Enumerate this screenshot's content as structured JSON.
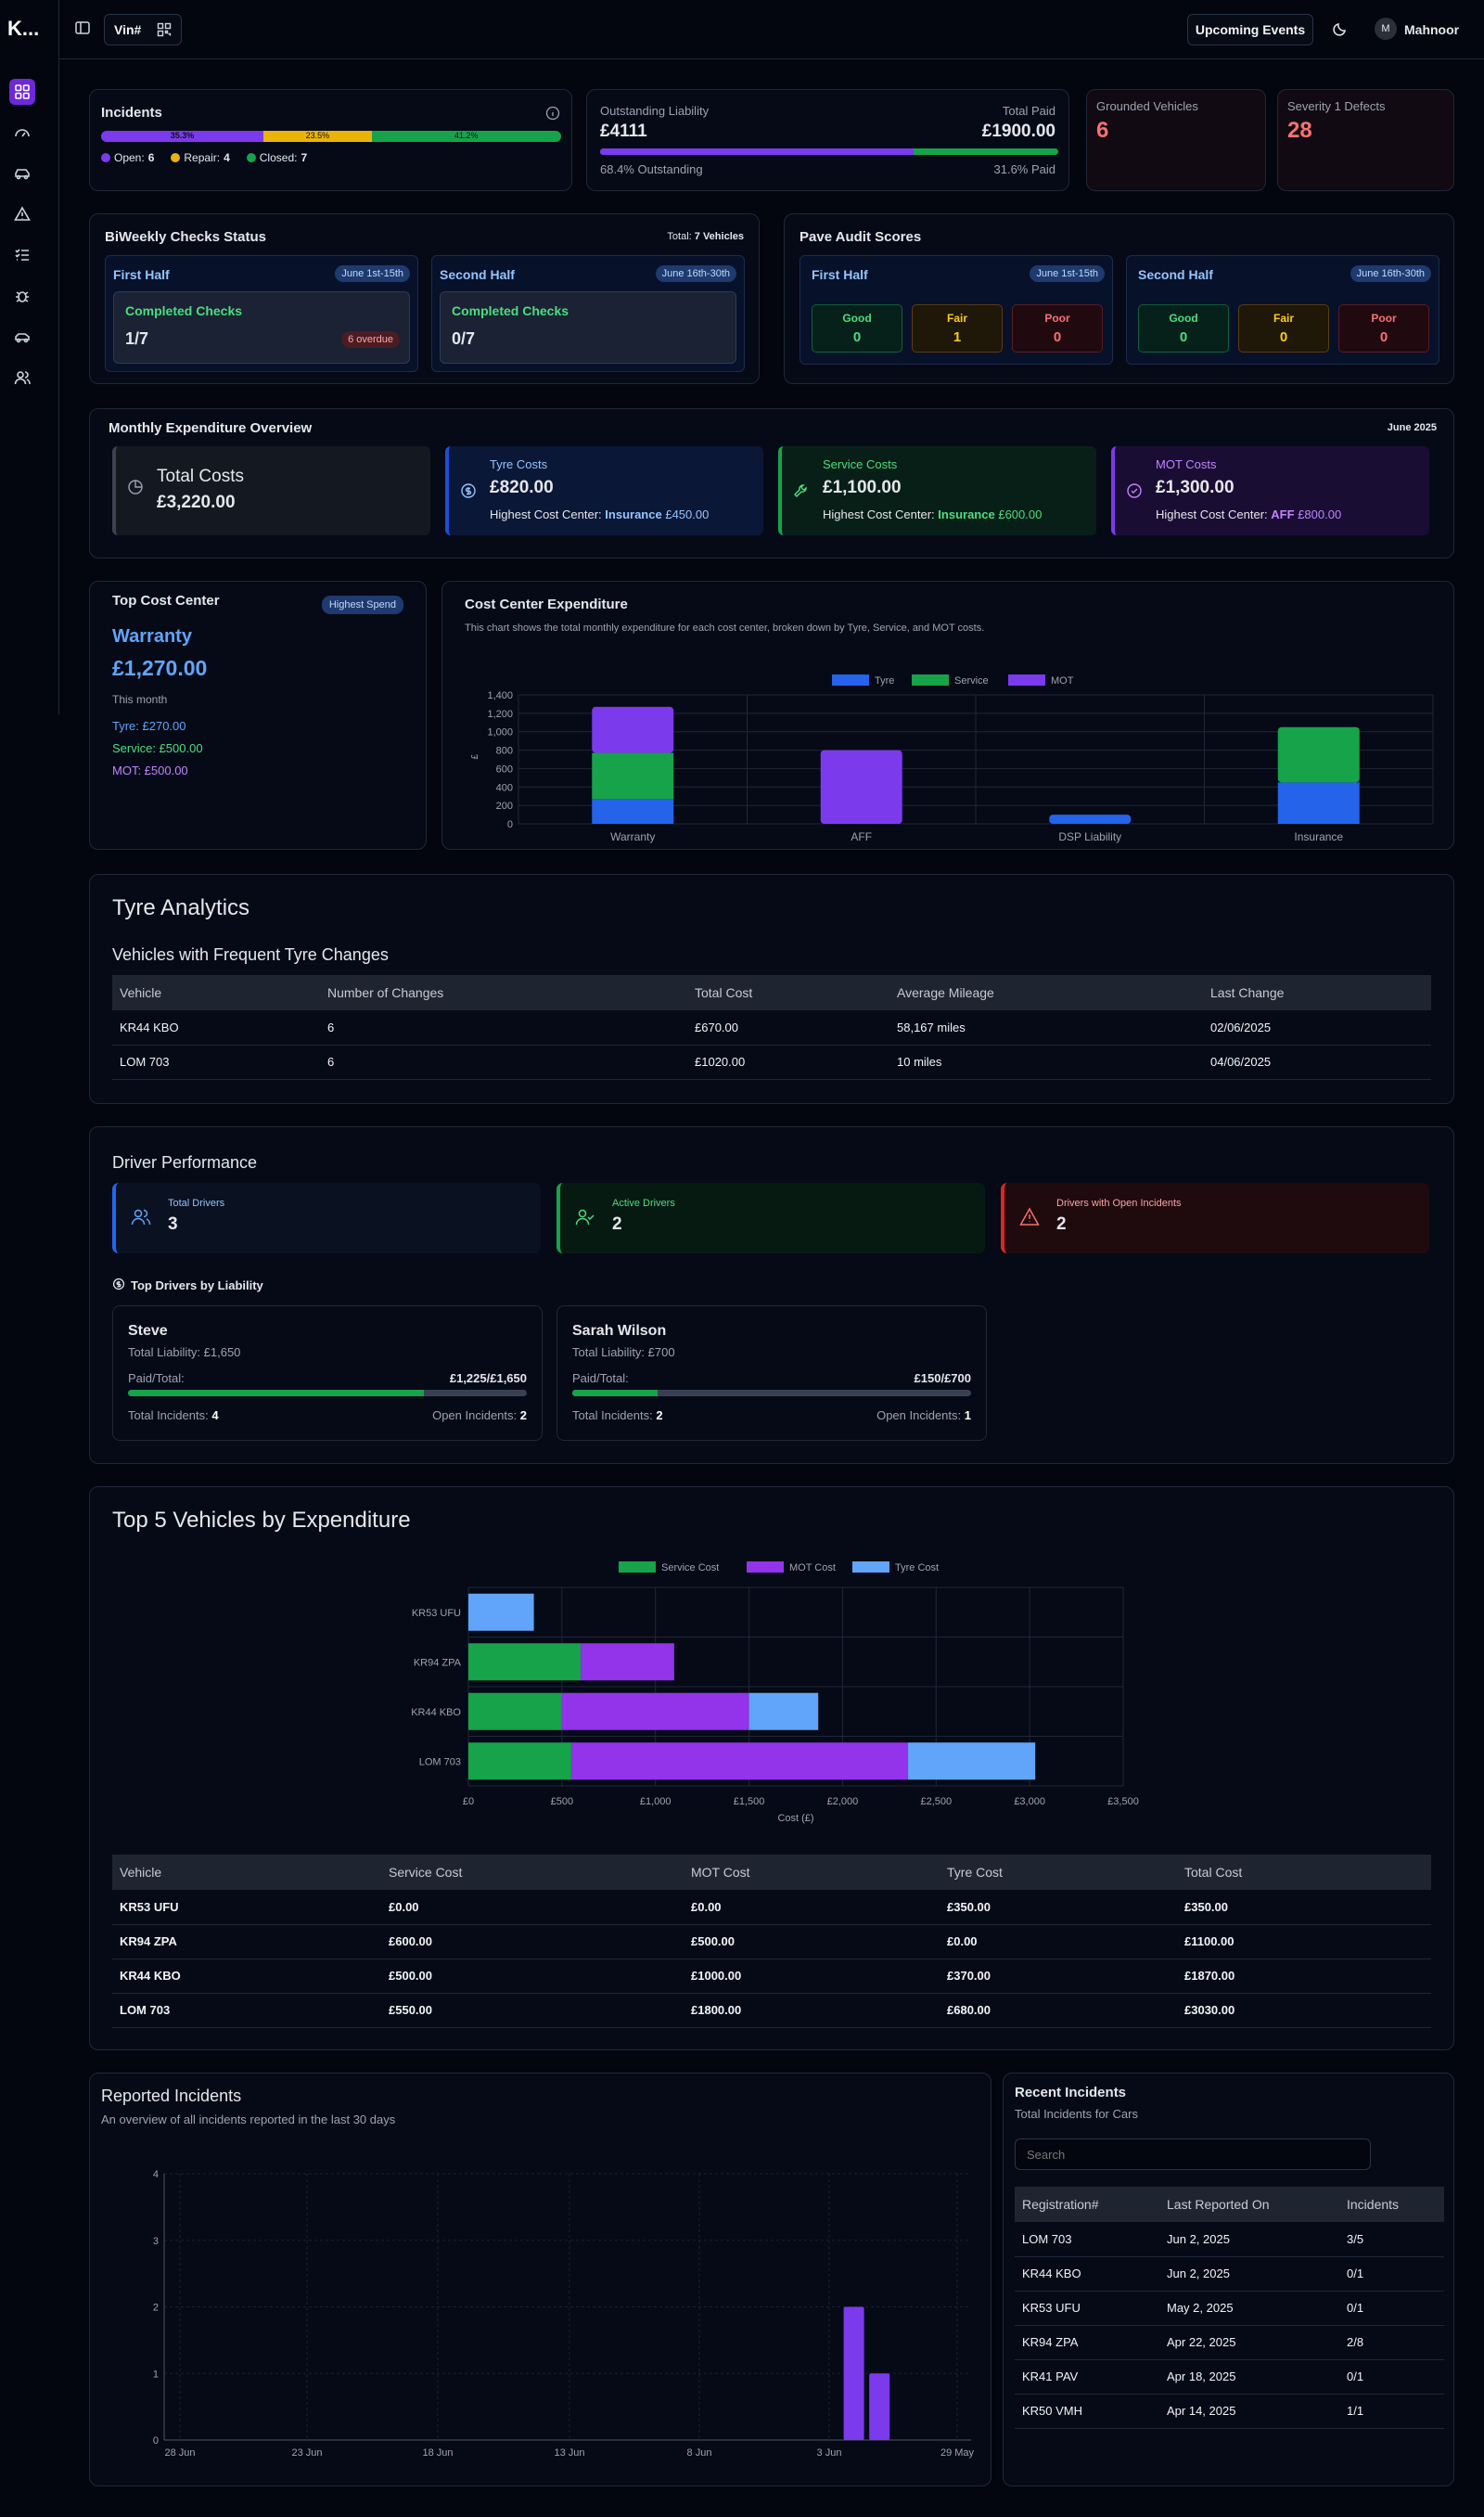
{
  "brand": "K...",
  "topbar": {
    "vin_label": "Vin#",
    "upcoming_events": "Upcoming Events",
    "user_initial": "M",
    "user_name": "Mahnoor"
  },
  "colors": {
    "purple": "#7c3aed",
    "green": "#16a34a",
    "yellow": "#eab308",
    "blue": "#2563eb",
    "red": "#f87171",
    "lightblue": "#60a5fa"
  },
  "incidents": {
    "title": "Incidents",
    "seg1": "35.3%",
    "seg2": "23.5%",
    "seg3": "41.2%",
    "open_label": "Open:",
    "open_val": "6",
    "repair_label": "Repair:",
    "repair_val": "4",
    "closed_label": "Closed:",
    "closed_val": "7",
    "open_frac": 0.353,
    "repair_frac": 0.235,
    "closed_frac": 0.412
  },
  "liability": {
    "title": "Outstanding Liability",
    "amount": "£4111",
    "paid_title": "Total Paid",
    "paid_amount": "£1900.00",
    "outstanding_pct": "68.4% Outstanding",
    "paid_pct": "31.6% Paid",
    "outstanding_frac": 0.684
  },
  "grounded": {
    "title": "Grounded Vehicles",
    "value": "6"
  },
  "severity": {
    "title": "Severity 1 Defects",
    "value": "28"
  },
  "biweekly": {
    "title": "BiWeekly Checks Status",
    "total_label": "Total:",
    "total_val": "7 Vehicles",
    "first": {
      "title": "First Half",
      "badge": "June 1st-15th",
      "label": "Completed Checks",
      "value": "1/7",
      "overdue": "6 overdue"
    },
    "second": {
      "title": "Second Half",
      "badge": "June 16th-30th",
      "label": "Completed Checks",
      "value": "0/7"
    }
  },
  "pave": {
    "title": "Pave Audit Scores",
    "first": {
      "title": "First Half",
      "badge": "June 1st-15th",
      "good_l": "Good",
      "good": "0",
      "fair_l": "Fair",
      "fair": "1",
      "poor_l": "Poor",
      "poor": "0"
    },
    "second": {
      "title": "Second Half",
      "badge": "June 16th-30th",
      "good_l": "Good",
      "good": "0",
      "fair_l": "Fair",
      "fair": "0",
      "poor_l": "Poor",
      "poor": "0"
    }
  },
  "monthly": {
    "title": "Monthly Expenditure Overview",
    "period": "June 2025",
    "total": {
      "label": "Total Costs",
      "value": "£3,220.00"
    },
    "tyre": {
      "label": "Tyre Costs",
      "value": "£820.00",
      "hc": "Highest Cost Center:",
      "center": "Insurance",
      "amt": "£450.00"
    },
    "service": {
      "label": "Service Costs",
      "value": "£1,100.00",
      "hc": "Highest Cost Center:",
      "center": "Insurance",
      "amt": "£600.00"
    },
    "mot": {
      "label": "MOT Costs",
      "value": "£1,300.00",
      "hc": "Highest Cost Center:",
      "center": "AFF",
      "amt": "£800.00"
    }
  },
  "topcenter": {
    "title": "Top Cost Center",
    "badge": "Highest Spend",
    "name": "Warranty",
    "amount": "£1,270.00",
    "period": "This month",
    "tyre": "Tyre: £270.00",
    "service": "Service: £500.00",
    "mot": "MOT: £500.00"
  },
  "cce": {
    "title": "Cost Center Expenditure",
    "desc": "This chart shows the total monthly expenditure for each cost center, broken down by Tyre, Service, and MOT costs.",
    "ylabel": "£"
  },
  "tyre_analytics": {
    "title": "Tyre Analytics",
    "subtitle": "Vehicles with Frequent Tyre Changes",
    "headers": [
      "Vehicle",
      "Number of Changes",
      "Total Cost",
      "Average Mileage",
      "Last Change"
    ],
    "rows": [
      [
        "KR44 KBO",
        "6",
        "£670.00",
        "58,167 miles",
        "02/06/2025"
      ],
      [
        "LOM 703",
        "6",
        "£1020.00",
        "10 miles",
        "04/06/2025"
      ]
    ]
  },
  "drivers": {
    "title": "Driver Performance",
    "total_l": "Total Drivers",
    "total": "3",
    "active_l": "Active Drivers",
    "active": "2",
    "open_l": "Drivers with Open Incidents",
    "open": "2",
    "top_title": "Top Drivers by Liability",
    "list": [
      {
        "name": "Steve",
        "liability": "Total Liability: £1,650",
        "paid_l": "Paid/Total:",
        "paid": "£1,225/£1,650",
        "inc_l": "Total Incidents:",
        "inc": "4",
        "open_l": "Open Incidents:",
        "open": "2",
        "frac": 0.742
      },
      {
        "name": "Sarah Wilson",
        "liability": "Total Liability: £700",
        "paid_l": "Paid/Total:",
        "paid": "£150/£700",
        "inc_l": "Total Incidents:",
        "inc": "2",
        "open_l": "Open Incidents:",
        "open": "1",
        "frac": 0.214
      }
    ]
  },
  "top5": {
    "title": "Top 5 Vehicles by Expenditure",
    "xlabel": "Cost (£)",
    "headers": [
      "Vehicle",
      "Service Cost",
      "MOT Cost",
      "Tyre Cost",
      "Total Cost"
    ],
    "rows": [
      [
        "KR53 UFU",
        "£0.00",
        "£0.00",
        "£350.00",
        "£350.00"
      ],
      [
        "KR94 ZPA",
        "£600.00",
        "£500.00",
        "£0.00",
        "£1100.00"
      ],
      [
        "KR44 KBO",
        "£500.00",
        "£1000.00",
        "£370.00",
        "£1870.00"
      ],
      [
        "LOM 703",
        "£550.00",
        "£1800.00",
        "£680.00",
        "£3030.00"
      ]
    ]
  },
  "reported": {
    "title": "Reported Incidents",
    "subtitle": "An overview of all incidents reported in the last 30 days"
  },
  "recent": {
    "title": "Recent Incidents",
    "subtitle": "Total Incidents for Cars",
    "search_placeholder": "Search",
    "headers": [
      "Registration#",
      "Last Reported On",
      "Incidents"
    ],
    "rows": [
      [
        "LOM 703",
        "Jun 2, 2025",
        "3/5"
      ],
      [
        "KR44 KBO",
        "Jun 2, 2025",
        "0/1"
      ],
      [
        "KR53 UFU",
        "May 2, 2025",
        "0/1"
      ],
      [
        "KR94 ZPA",
        "Apr 22, 2025",
        "2/8"
      ],
      [
        "KR41 PAV",
        "Apr 18, 2025",
        "0/1"
      ],
      [
        "KR50 VMH",
        "Apr 14, 2025",
        "1/1"
      ]
    ]
  },
  "chart_data": [
    {
      "type": "bar",
      "title": "Cost Center Expenditure",
      "categories": [
        "Warranty",
        "AFF",
        "DSP Liability",
        "Insurance"
      ],
      "series": [
        {
          "name": "Tyre",
          "values": [
            270,
            0,
            100,
            450
          ]
        },
        {
          "name": "Service",
          "values": [
            500,
            0,
            0,
            600
          ]
        },
        {
          "name": "MOT",
          "values": [
            500,
            800,
            0,
            0
          ]
        }
      ],
      "ylabel": "£",
      "ylim": [
        0,
        1400
      ],
      "yticks": [
        0,
        200,
        400,
        600,
        800,
        1000,
        1200,
        1400
      ],
      "stacked": true,
      "legend": "top"
    },
    {
      "type": "bar",
      "title": "Top 5 Vehicles by Expenditure",
      "orientation": "horizontal",
      "categories": [
        "KR53 UFU",
        "KR94 ZPA",
        "KR44 KBO",
        "LOM 703"
      ],
      "series": [
        {
          "name": "Service Cost",
          "values": [
            0,
            600,
            500,
            550
          ]
        },
        {
          "name": "MOT Cost",
          "values": [
            0,
            500,
            1000,
            1800
          ]
        },
        {
          "name": "Tyre Cost",
          "values": [
            350,
            0,
            370,
            680
          ]
        }
      ],
      "xlabel": "Cost (£)",
      "xlim": [
        0,
        3500
      ],
      "xticks": [
        "£0",
        "£500",
        "£1,000",
        "£1,500",
        "£2,000",
        "£2,500",
        "£3,000",
        "£3,500"
      ],
      "stacked": true,
      "legend": "top"
    },
    {
      "type": "bar",
      "title": "Reported Incidents",
      "x": [
        "29 May",
        "3 Jun",
        "8 Jun",
        "13 Jun",
        "18 Jun",
        "23 Jun",
        "28 Jun"
      ],
      "bars": [
        {
          "date": "Jun 2",
          "value": 2
        },
        {
          "date": "Jun 1",
          "value": 1
        }
      ],
      "ylim": [
        0,
        4
      ],
      "yticks": [
        0,
        1,
        2,
        3,
        4
      ]
    }
  ]
}
